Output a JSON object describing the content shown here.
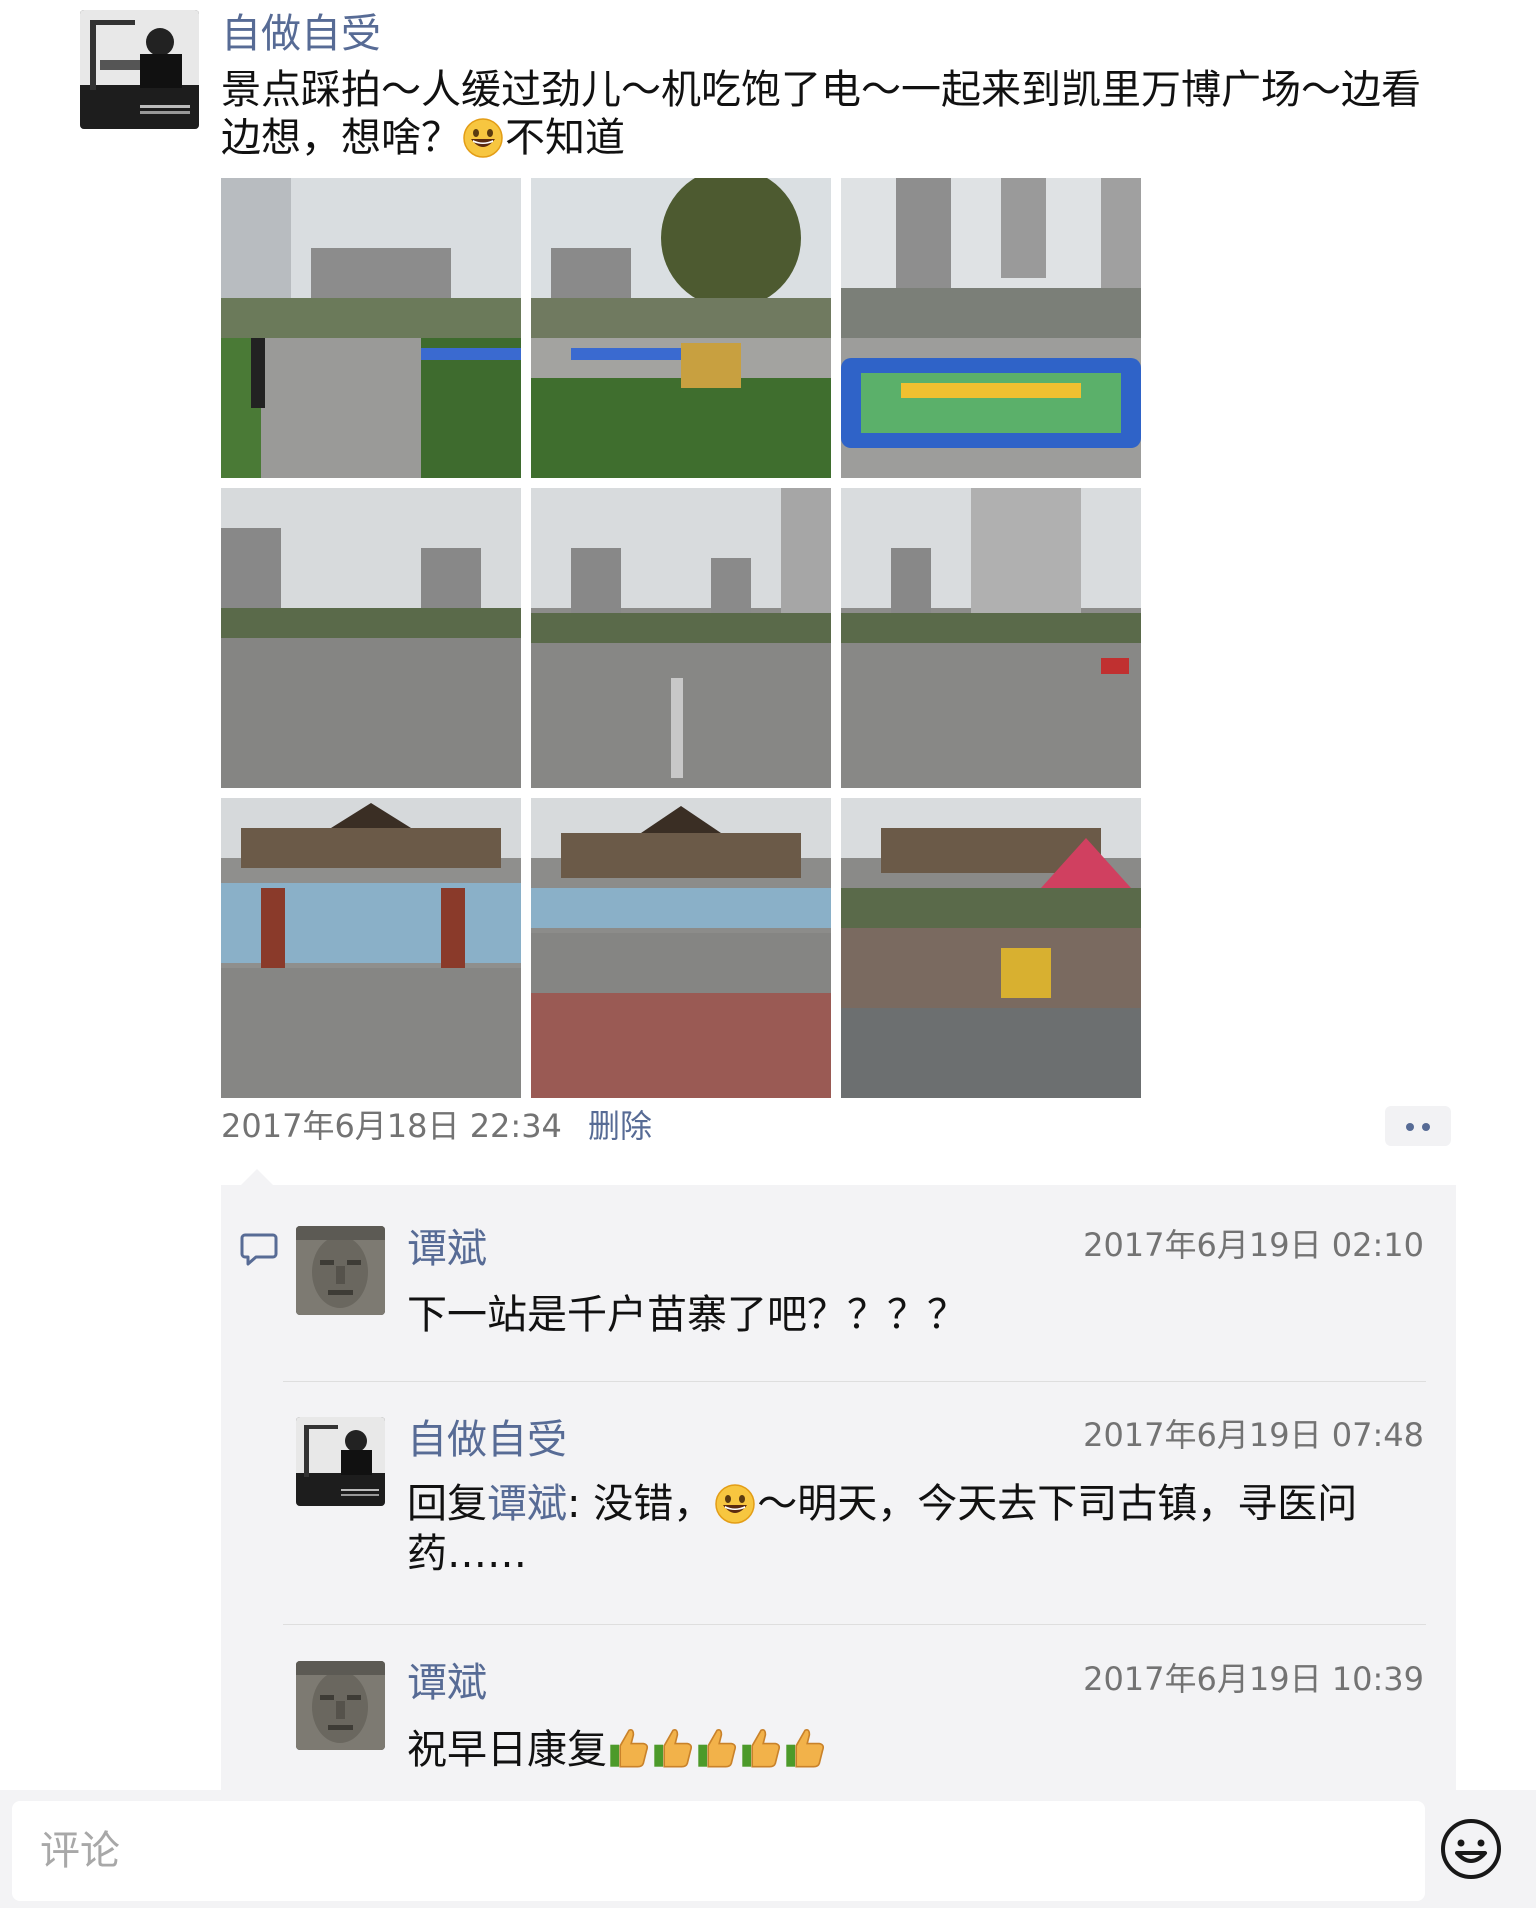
{
  "post": {
    "author": "自做自受",
    "text_before_emoji": "景点踩拍～人缓过劲儿～机吃饱了电～一起来到凯里万博广场～边看边想，想啥？",
    "text_after_emoji": "不知道",
    "emoji_icon": "grinning-face-icon",
    "photos": [
      {
        "name": "photo-plaza-street-1",
        "scene": "plaza with trees and inflatable pool"
      },
      {
        "name": "photo-plaza-street-2",
        "scene": "plaza with trees and inflatable pool"
      },
      {
        "name": "photo-plaza-pool",
        "scene": "children ball pool"
      },
      {
        "name": "photo-square-1",
        "scene": "empty square"
      },
      {
        "name": "photo-square-2",
        "scene": "empty square"
      },
      {
        "name": "photo-square-3",
        "scene": "empty square"
      },
      {
        "name": "photo-building-1",
        "scene": "building with gate"
      },
      {
        "name": "photo-building-2",
        "scene": "building with gate"
      },
      {
        "name": "photo-building-3",
        "scene": "building with kids cars"
      }
    ],
    "timestamp": "2017年6月18日 22:34",
    "delete_label": "删除"
  },
  "comments": [
    {
      "author": "谭斌",
      "time": "2017年6月19日 02:10",
      "text": "下一站是千户苗寨了吧？？？？"
    },
    {
      "author": "自做自受",
      "time": "2017年6月19日 07:48",
      "reply_prefix": "回复",
      "reply_to": "谭斌",
      "text_before_emoji": ": 没错，",
      "text_after_emoji": "～明天，今天去下司古镇，寻医问药……"
    },
    {
      "author": "谭斌",
      "time": "2017年6月19日 10:39",
      "text": "祝早日康复",
      "emoji_icon": "thumbs-up-icon",
      "emoji_count": 5
    }
  ],
  "input": {
    "placeholder": "评论"
  },
  "colors": {
    "link_blue": "#576b95",
    "meta_gray": "#737373",
    "comment_bg": "#f3f3f5"
  }
}
